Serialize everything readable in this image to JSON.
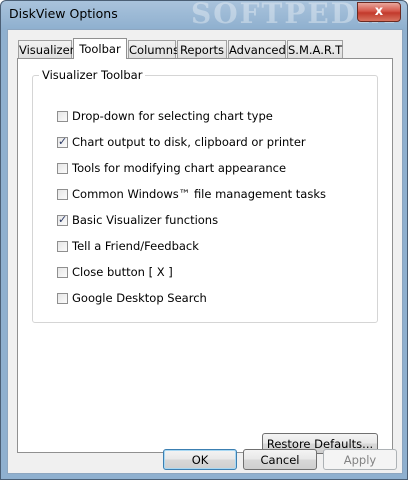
{
  "window": {
    "title": "DiskView Options",
    "watermark": "SOFTPEDIA",
    "close_label": "x"
  },
  "tabs": [
    {
      "label": "Visualizer"
    },
    {
      "label": "Toolbar",
      "active": true
    },
    {
      "label": "Columns"
    },
    {
      "label": "Reports"
    },
    {
      "label": "Advanced"
    },
    {
      "label": "S.M.A.R.T"
    }
  ],
  "group": {
    "title": "Visualizer Toolbar",
    "options": [
      {
        "label": "Drop-down for selecting chart type",
        "checked": false
      },
      {
        "label": "Chart output to disk, clipboard or printer",
        "checked": true
      },
      {
        "label": "Tools for modifying chart appearance",
        "checked": false
      },
      {
        "label": "Common Windows™ file management tasks",
        "checked": false
      },
      {
        "label": "Basic Visualizer functions",
        "checked": true
      },
      {
        "label": "Tell a Friend/Feedback",
        "checked": false
      },
      {
        "label": "Close button [ X ]",
        "checked": false
      },
      {
        "label": "Google Desktop Search",
        "checked": false
      }
    ]
  },
  "buttons": {
    "restore_defaults": "Restore Defaults...",
    "ok": "OK",
    "cancel": "Cancel",
    "apply": "Apply"
  }
}
